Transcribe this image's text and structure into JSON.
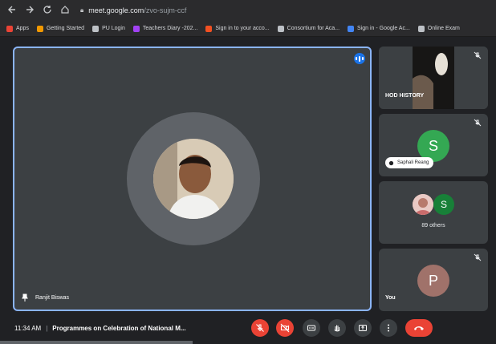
{
  "browser": {
    "url_domain": "meet.google.com",
    "url_path": "/zvo-sujm-ccf",
    "bookmarks": [
      {
        "label": "Apps",
        "icon": "apps-grid-icon",
        "color": "#ea4335"
      },
      {
        "label": "Getting Started",
        "icon": "firefox-icon",
        "color": "#f29900"
      },
      {
        "label": "PU Login",
        "icon": "globe-icon",
        "color": "#bdc1c6"
      },
      {
        "label": "Teachers Diary -202...",
        "icon": "bookmark-icon",
        "color": "#a142f4"
      },
      {
        "label": "Sign in to your acco...",
        "icon": "microsoft-icon",
        "color": "#f25022"
      },
      {
        "label": "Consortium for Aca...",
        "icon": "globe-icon",
        "color": "#bdc1c6"
      },
      {
        "label": "Sign in - Google Ac...",
        "icon": "google-icon",
        "color": "#4285f4"
      },
      {
        "label": "Online Exam",
        "icon": "globe-icon",
        "color": "#bdc1c6"
      }
    ]
  },
  "main_tile": {
    "name": "Ranjit Biswas"
  },
  "side_tiles": {
    "tile1": {
      "name": "HOD HISTORY"
    },
    "tile2": {
      "initial": "S",
      "chip": "Saphali Reang",
      "color": "#34a853"
    },
    "tile3": {
      "initial": "S",
      "others": "89 others",
      "color": "#188038"
    },
    "tile4": {
      "initial": "P",
      "name": "You",
      "color": "#a0726a"
    }
  },
  "bottom": {
    "time": "11:34 AM",
    "separator": "|",
    "meeting_title": "Programmes on Celebration of National M..."
  },
  "colors": {
    "accent": "#8ab4f8",
    "danger": "#ea4335",
    "tile_bg": "#3c4043",
    "app_bg": "#202124"
  }
}
